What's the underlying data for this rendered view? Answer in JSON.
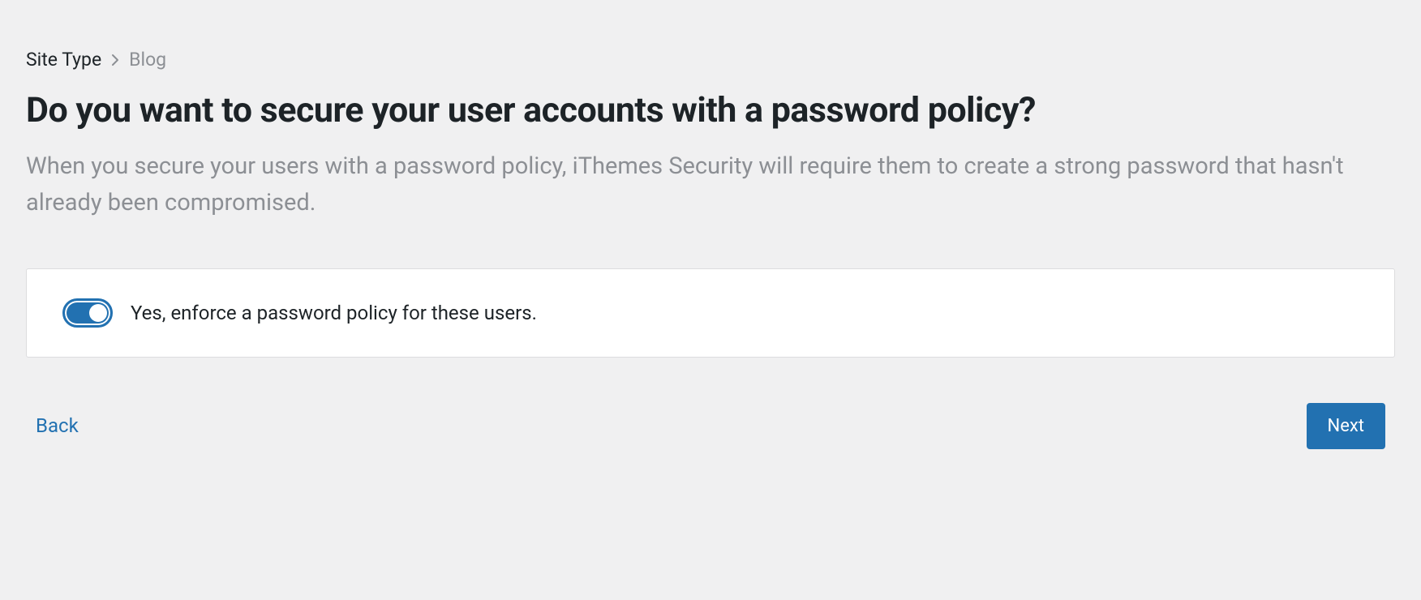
{
  "breadcrumb": {
    "parent": "Site Type",
    "current": "Blog"
  },
  "header": {
    "title": "Do you want to secure your user accounts with a password policy?",
    "subtitle": "When you secure your users with a password policy, iThemes Security will require them to create a strong password that hasn't already been compromised."
  },
  "option": {
    "toggle_enabled": true,
    "label": "Yes, enforce a password policy for these users."
  },
  "nav": {
    "back_label": "Back",
    "next_label": "Next"
  }
}
